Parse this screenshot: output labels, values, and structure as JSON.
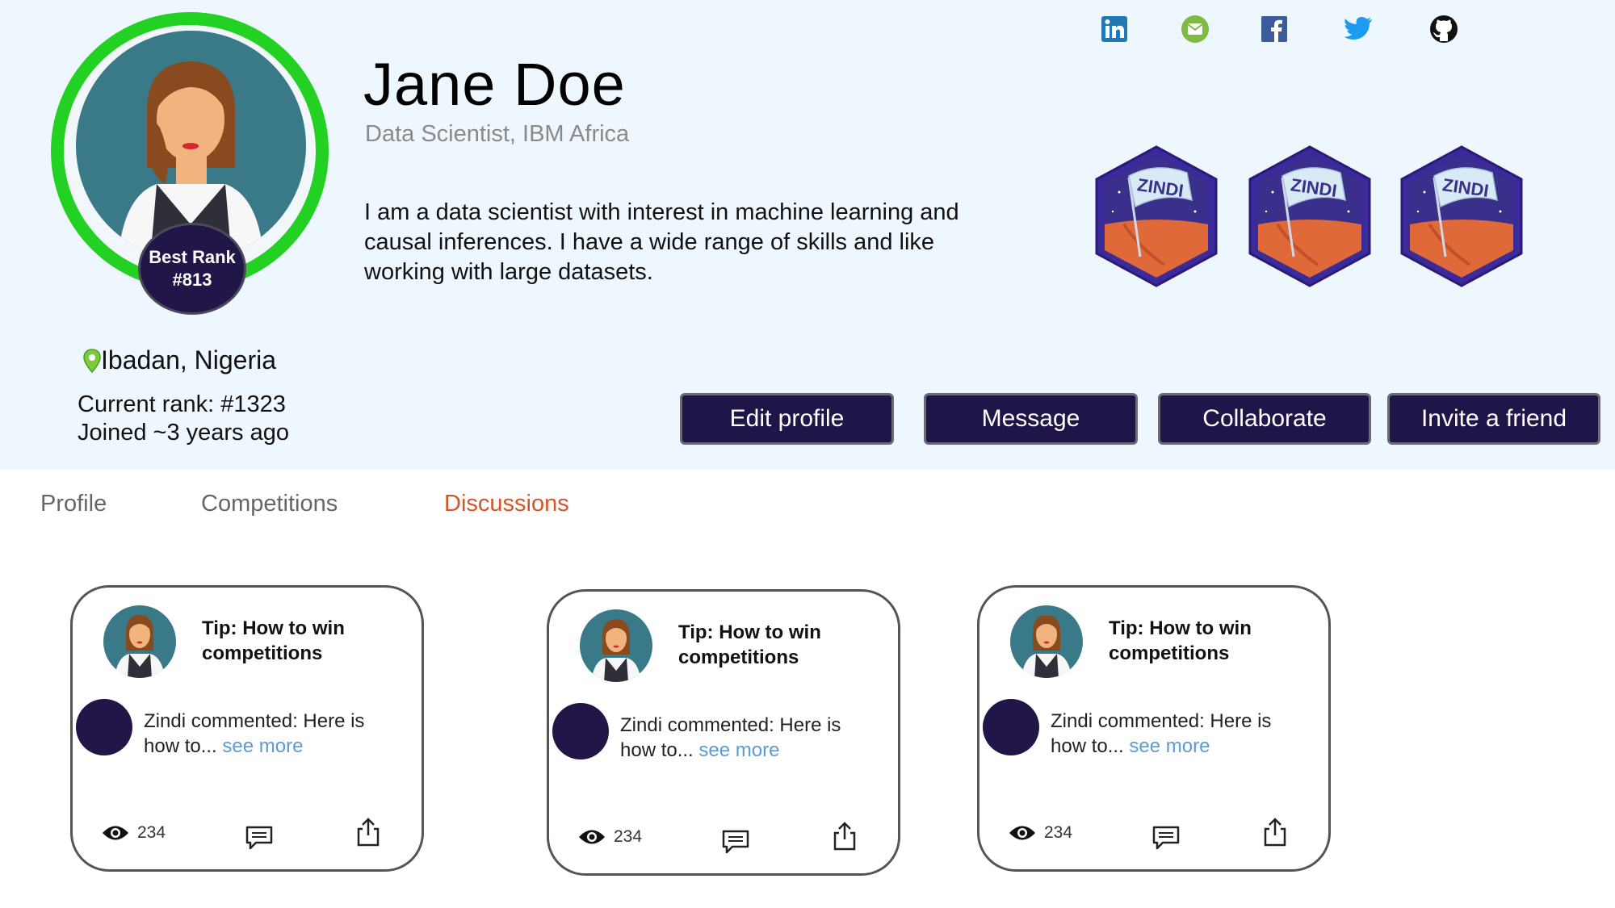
{
  "profile": {
    "name": "Jane Doe",
    "subtitle": "Data Scientist, IBM Africa",
    "bio": "I am a data scientist with interest in machine learning and causal inferences. I have a wide range of skills and like working with large datasets.",
    "best_rank_label": "Best Rank",
    "best_rank_value": "#813",
    "location": "Ibadan, Nigeria",
    "current_rank": "Current rank: #1323",
    "joined": "Joined ~3 years ago"
  },
  "social_icons": [
    "linkedin-icon",
    "email-icon",
    "facebook-icon",
    "twitter-icon",
    "github-icon"
  ],
  "badges": [
    {
      "text": "ZINDI"
    },
    {
      "text": "ZINDI"
    },
    {
      "text": "ZINDI"
    }
  ],
  "actions": {
    "edit": "Edit profile",
    "message": "Message",
    "collaborate": "Collaborate",
    "invite": "Invite a friend"
  },
  "tabs": [
    {
      "label": "Profile",
      "active": false
    },
    {
      "label": "Competitions",
      "active": false
    },
    {
      "label": "Discussions",
      "active": true
    }
  ],
  "cards": [
    {
      "title": "Tip: How to win competitions",
      "comment": "Zindi commented: Here is how to...",
      "see_more": "see more",
      "views": "234"
    },
    {
      "title": "Tip: How to win competitions",
      "comment": "Zindi commented: Here is how to...",
      "see_more": "see more",
      "views": "234"
    },
    {
      "title": "Tip: How to win competitions",
      "comment": "Zindi commented: Here is how to...",
      "see_more": "see more",
      "views": "234"
    }
  ],
  "colors": {
    "header_bg": "#eef6fe",
    "ring_green": "#23d122",
    "navy": "#1f1549",
    "active_tab": "#d4552a",
    "link": "#5b9bd5"
  }
}
